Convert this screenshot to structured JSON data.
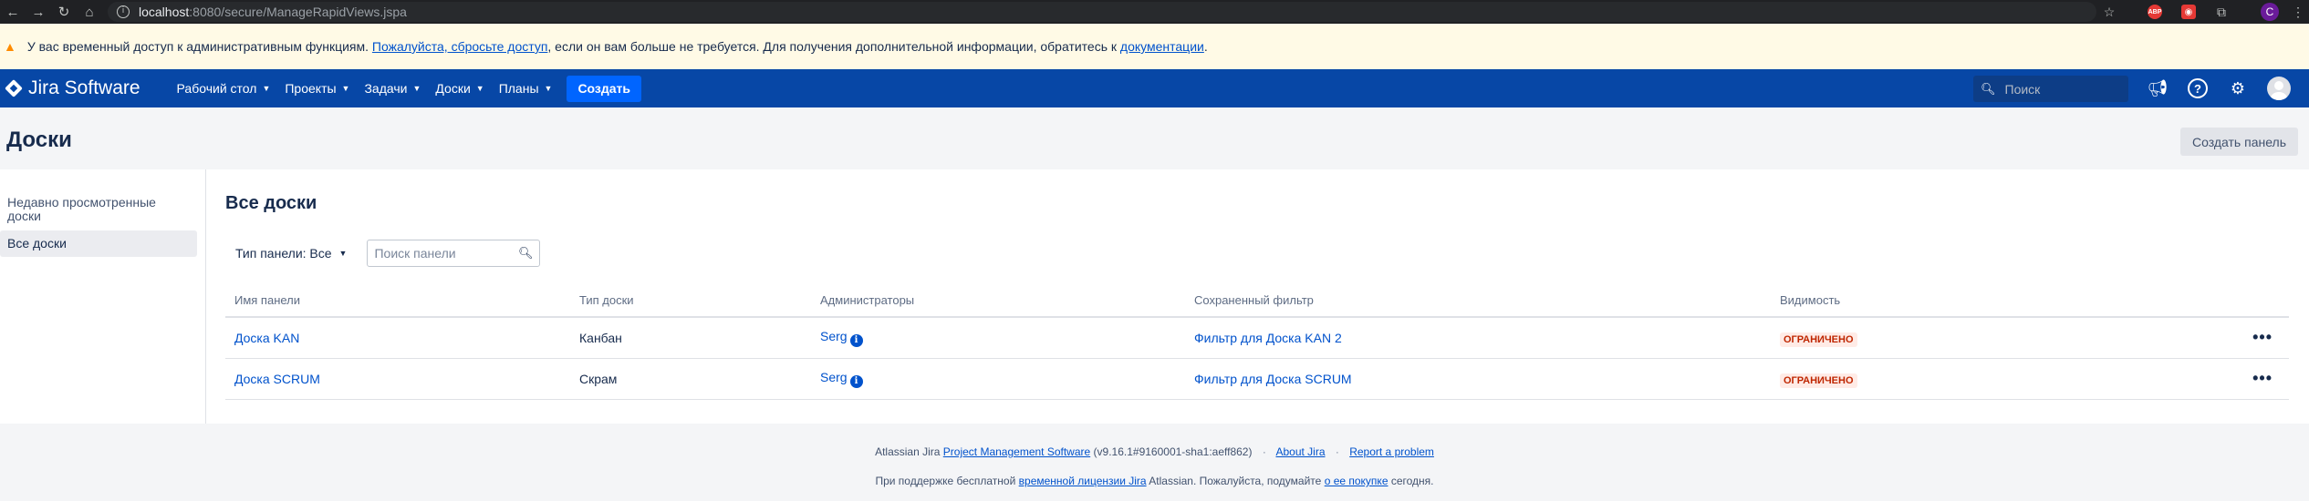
{
  "browser": {
    "url_host": "localhost",
    "url_path": ":8080/secure/ManageRapidViews.jspa",
    "abp_label": "ABP",
    "avatar_letter": "C"
  },
  "banner": {
    "text_before": "У вас временный доступ к административным функциям.",
    "link_reset": "Пожалуйста, сбросьте доступ",
    "text_middle": ", если он вам больше не требуется. Для получения дополнительной информации, обратитесь к",
    "link_docs": "документации",
    "text_after": "."
  },
  "header": {
    "logo": "Jira Software",
    "menu": [
      "Рабочий стол",
      "Проекты",
      "Задачи",
      "Доски",
      "Планы"
    ],
    "create": "Создать",
    "search_placeholder": "Поиск",
    "brand_color": "#0747a6"
  },
  "page": {
    "title": "Доски",
    "create_panel": "Создать панель"
  },
  "sidebar": {
    "items": [
      "Недавно просмотренные доски",
      "Все доски"
    ]
  },
  "main": {
    "heading": "Все доски",
    "type_filter": "Тип панели: Все",
    "search_placeholder": "Поиск панели",
    "columns": [
      "Имя панели",
      "Тип доски",
      "Администраторы",
      "Сохраненный фильтр",
      "Видимость"
    ],
    "rows": [
      {
        "name": "Доска KAN",
        "type": "Канбан",
        "admin": "Serg",
        "filter": "Фильтр для Доска KAN 2",
        "visibility": "ОГРАНИЧЕНО"
      },
      {
        "name": "Доска SCRUM",
        "type": "Скрам",
        "admin": "Serg",
        "filter": "Фильтр для Доска SCRUM",
        "visibility": "ОГРАНИЧЕНО"
      }
    ]
  },
  "footer": {
    "l1_prefix": "Atlassian Jira",
    "l1_link": "Project Management Software",
    "l1_version": "(v9.16.1#9160001-sha1:aeff862)",
    "l1_about": "About Jira",
    "l1_report": "Report a problem",
    "l2_prefix": "При поддержке бесплатной",
    "l2_link": "временной лицензии Jira",
    "l2_middle": "Atlassian. Пожалуйста, подумайте",
    "l2_link2": "о ее покупке",
    "l2_suffix": "сегодня."
  }
}
